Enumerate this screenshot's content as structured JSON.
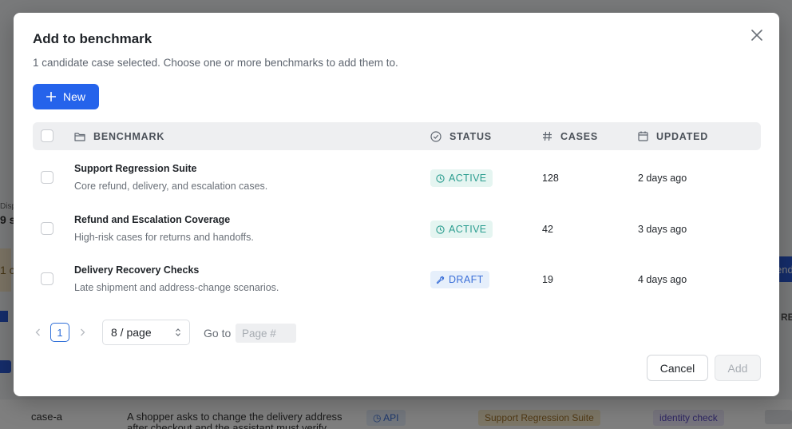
{
  "background": {
    "fragments": [
      "Disp",
      "9 s",
      "1 c",
      "end",
      "RE"
    ],
    "row": {
      "id": "case-a",
      "text_line1": "A shopper asks to change the delivery address",
      "text_line2": "after checkout and the assistant must verify",
      "tag_api": "API",
      "tag_benchmark": "Support Regression Suite",
      "tag_identity": "identity check"
    }
  },
  "modal": {
    "title": "Add to benchmark",
    "subtitle": "1 candidate case selected. Choose one or more benchmarks to add them to.",
    "new_button": "New",
    "columns": {
      "benchmark": "BENCHMARK",
      "status": "STATUS",
      "cases": "CASES",
      "updated": "UPDATED"
    },
    "rows": [
      {
        "name": "Support Regression Suite",
        "description": "Core refund, delivery, and escalation cases.",
        "status": "ACTIVE",
        "status_icon": "clock-icon",
        "cases": "128",
        "updated": "2 days ago"
      },
      {
        "name": "Refund and Escalation Coverage",
        "description": "High-risk cases for returns and handoffs.",
        "status": "ACTIVE",
        "status_icon": "clock-icon",
        "cases": "42",
        "updated": "3 days ago"
      },
      {
        "name": "Delivery Recovery Checks",
        "description": "Late shipment and address-change scenarios.",
        "status": "DRAFT",
        "status_icon": "wrench-icon",
        "cases": "19",
        "updated": "4 days ago"
      }
    ],
    "pagination": {
      "current_page": "1",
      "per_page": "8 / page",
      "goto_label": "Go to",
      "goto_placeholder": "Page #"
    },
    "cancel_button": "Cancel",
    "add_button": "Add"
  },
  "colors": {
    "primary": "#2563eb",
    "active_bg": "#e5f5f1",
    "active_text": "#2a9d8f",
    "draft_bg": "#e6effb",
    "draft_text": "#3b6fd8"
  }
}
